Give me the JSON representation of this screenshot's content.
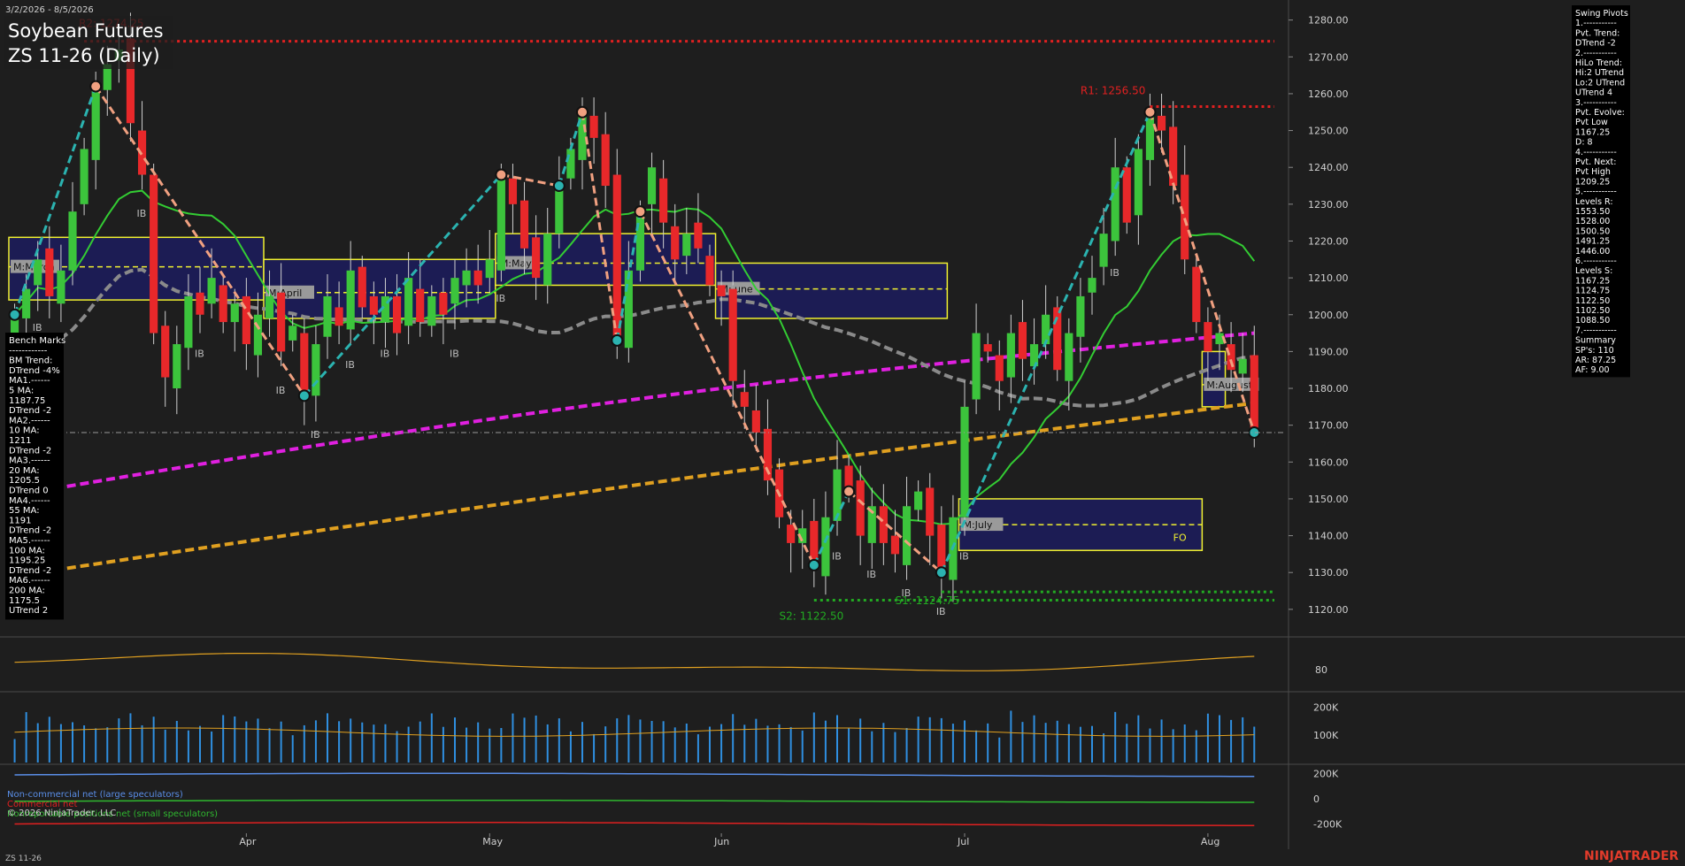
{
  "header": {
    "date_range": "3/2/2026 - 8/5/2026",
    "title_line1": "Soybean Futures",
    "title_line2": "ZS 11-26 (Daily)",
    "corner_label": "ZS 11-26",
    "brand": "NINJATRADER",
    "copyright": "© 2026 NinjaTrader, LLC"
  },
  "colors": {
    "bg": "#1e1e1e",
    "up": "#3cc43c",
    "down": "#e8282a",
    "teal": "#2bb3b0",
    "salmon": "#f0a080",
    "magenta": "#e020e0",
    "gold": "#e0a020",
    "gray_ma": "#8a8a8a",
    "green_ma": "#33cc33",
    "box_fill": "#1c1c5a",
    "box_edge": "#f0f030",
    "volume": "#2f8fe0"
  },
  "chart_data": [
    {
      "type": "candlestick",
      "name": "price",
      "ylim": [
        1113,
        1284
      ],
      "yticks": [
        1120,
        1130,
        1140,
        1150,
        1160,
        1170,
        1180,
        1190,
        1200,
        1210,
        1220,
        1230,
        1240,
        1250,
        1260,
        1270,
        1280
      ],
      "xticks": [
        "Apr",
        "May",
        "Jun",
        "Jul",
        "Aug"
      ],
      "xtick_index": [
        20,
        41,
        61,
        82,
        103
      ],
      "bars_count": 108,
      "closes": [
        1200,
        1207,
        1215,
        1205,
        1212,
        1228,
        1245,
        1262,
        1268,
        1272,
        1252,
        1238,
        1195,
        1183,
        1192,
        1205,
        1200,
        1210,
        1198,
        1203,
        1192,
        1200,
        1205,
        1190,
        1197,
        1178,
        1192,
        1205,
        1197,
        1212,
        1202,
        1200,
        1205,
        1195,
        1210,
        1198,
        1205,
        1200,
        1210,
        1212,
        1208,
        1215,
        1238,
        1230,
        1218,
        1210,
        1222,
        1235,
        1245,
        1255,
        1248,
        1235,
        1193,
        1212,
        1228,
        1240,
        1225,
        1215,
        1222,
        1218,
        1208,
        1205,
        1182,
        1175,
        1168,
        1155,
        1145,
        1138,
        1142,
        1132,
        1145,
        1158,
        1152,
        1140,
        1148,
        1138,
        1135,
        1148,
        1152,
        1140,
        1130,
        1145,
        1175,
        1195,
        1190,
        1182,
        1195,
        1188,
        1192,
        1200,
        1185,
        1195,
        1205,
        1210,
        1222,
        1240,
        1225,
        1245,
        1255,
        1250,
        1235,
        1215,
        1198,
        1190,
        1195,
        1185,
        1188,
        1168
      ],
      "pivot_high_labels": [
        "R1: 1256.50",
        "R2: 1274.25"
      ],
      "pivot_low_labels": [
        "S1: 1124.75",
        "S2: 1122.50"
      ],
      "pivot_levels": {
        "R1": 1256.5,
        "R2": 1274.25,
        "S1": 1124.75,
        "S2": 1122.5
      },
      "reference_line": 1168,
      "month_boxes": [
        {
          "label": "M:March",
          "top": 1221,
          "bottom": 1204,
          "mid": 1213,
          "x0": 0,
          "x1": 21
        },
        {
          "label": "M:April",
          "top": 1215,
          "bottom": 1199,
          "mid": 1206,
          "x0": 22,
          "x1": 41
        },
        {
          "label": "M:May",
          "top": 1222,
          "bottom": 1208,
          "mid": 1214,
          "x0": 42,
          "x1": 60
        },
        {
          "label": "M:June",
          "top": 1214,
          "bottom": 1199,
          "mid": 1207,
          "x0": 61,
          "x1": 80
        },
        {
          "label": "M:July",
          "top": 1150,
          "bottom": 1136,
          "mid": 1143,
          "x0": 82,
          "x1": 102
        },
        {
          "label": "M:August",
          "top": 1190,
          "bottom": 1175,
          "mid": 1181,
          "x0": 103,
          "x1": 104
        }
      ],
      "ib_markers": [
        "IB",
        "IB",
        "IB",
        "IB",
        "IB",
        "IB",
        "IB",
        "IB",
        "IB",
        "IB",
        "IB",
        "IB",
        "IB",
        "IB",
        "IB"
      ],
      "fo_marker": "FO",
      "series": [
        {
          "name": "200 MA",
          "color": "#e0a020",
          "values_start": 1129,
          "values_end": 1176
        },
        {
          "name": "100 MA",
          "color": "#e020e0",
          "values_start": 1151,
          "values_end": 1195
        },
        {
          "name": "55 MA",
          "color": "#8a8a8a",
          "values_start": 1159,
          "values_end": 1191
        },
        {
          "name": "20 MA",
          "color": "#33cc33",
          "values_start": 1189,
          "values_end": 1205
        }
      ]
    },
    {
      "type": "line",
      "name": "oscillator",
      "ylim": [
        60,
        110
      ],
      "yticks": [
        80
      ]
    },
    {
      "type": "bar",
      "name": "volume",
      "ylim": [
        0,
        250000
      ],
      "ytick_labels": [
        "200K",
        "100K"
      ],
      "ytick_values": [
        200000,
        100000
      ]
    },
    {
      "type": "line",
      "name": "cot",
      "ylim": [
        -260000,
        260000
      ],
      "ytick_labels": [
        "200K",
        "0",
        "-200K"
      ],
      "ytick_values": [
        200000,
        0,
        -200000
      ],
      "legend": [
        {
          "name": "Non-commercial net (large speculators)",
          "color": "#5a8ee8"
        },
        {
          "name": "Commercial net",
          "color": "#e02020"
        },
        {
          "name": "Nonreportable positions net (small speculators)",
          "color": "#2fb82f"
        }
      ]
    }
  ],
  "bench_marks": {
    "lines": [
      "Bench Marks",
      "------------",
      "BM Trend:",
      "DTrend -4%",
      "MA1.------",
      "5 MA:",
      "1187.75",
      "DTrend -2",
      "MA2.------",
      "10 MA:",
      "1211",
      "DTrend -2",
      "MA3.------",
      "20 MA:",
      "1205.5",
      "DTrend 0",
      "MA4.------",
      "55 MA:",
      "1191",
      "DTrend -2",
      "MA5.------",
      "100 MA:",
      "1195.25",
      "DTrend -2",
      "MA6.------",
      "200 MA:",
      "1175.5",
      "UTrend 2"
    ]
  },
  "swing_pivots": {
    "lines": [
      "Swing Pivots",
      "1.-----------",
      "Pvt. Trend:",
      "DTrend -2",
      "2.-----------",
      "HiLo Trend:",
      "Hi:2 UTrend",
      "Lo:2 UTrend",
      "UTrend 4",
      "3.-----------",
      "Pvt. Evolve:",
      "Pvt Low",
      "1167.25",
      "D: 8",
      "4.-----------",
      "Pvt. Next:",
      "Pvt High",
      "1209.25",
      "5.-----------",
      "Levels R:",
      "1553.50",
      "1528.00",
      "1500.50",
      "1491.25",
      "1446.00",
      "6.-----------",
      "Levels S:",
      "1167.25",
      "1124.75",
      "1122.50",
      "1102.50",
      "1088.50",
      "7.-----------",
      "Summary",
      "SP's: 110",
      "AR: 87.25",
      "AF: 9.00"
    ]
  }
}
